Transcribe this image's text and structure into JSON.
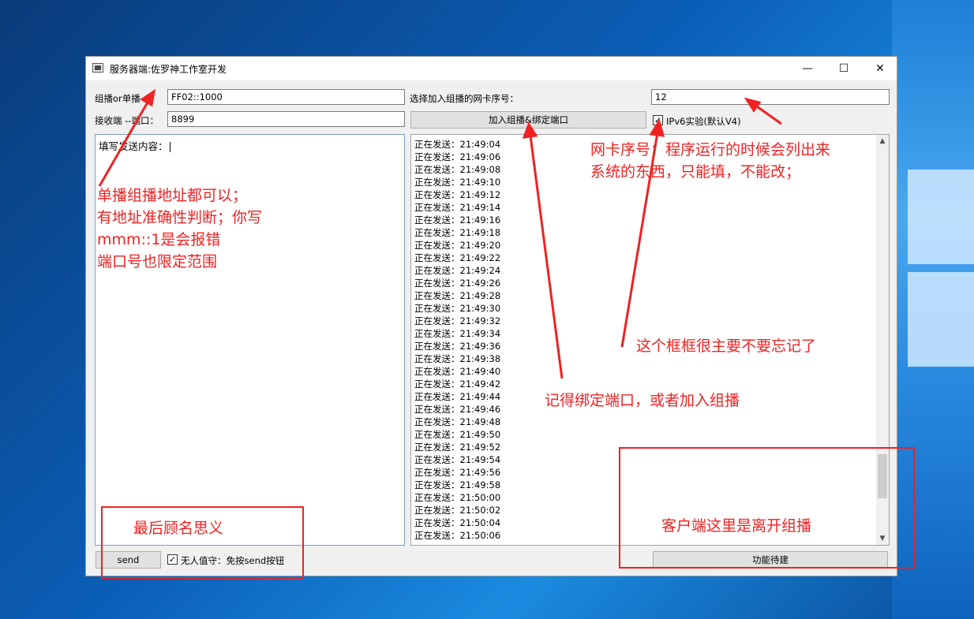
{
  "window": {
    "title": "服务器端:佐罗神工作室开发",
    "controls": {
      "minimize": "—",
      "maximize": "☐",
      "close": "✕"
    }
  },
  "form": {
    "group_label": "组播or单播  ：",
    "group_value": "FF02::1000",
    "port_label": "接收端 --端口：",
    "port_value": "8899",
    "nic_label": "选择加入组播的网卡序号：",
    "nic_value": "12",
    "join_button": "加入组播&绑定端口",
    "ipv6_label": "IPv6实验(默认V4)",
    "ipv6_checked": "✓"
  },
  "send_area": {
    "text": "填写发送内容："
  },
  "log": {
    "lines": [
      "正在发送：21:49:04",
      "正在发送：21:49:06",
      "正在发送：21:49:08",
      "正在发送：21:49:10",
      "正在发送：21:49:12",
      "正在发送：21:49:14",
      "正在发送：21:49:16",
      "正在发送：21:49:18",
      "正在发送：21:49:20",
      "正在发送：21:49:22",
      "正在发送：21:49:24",
      "正在发送：21:49:26",
      "正在发送：21:49:28",
      "正在发送：21:49:30",
      "正在发送：21:49:32",
      "正在发送：21:49:34",
      "正在发送：21:49:36",
      "正在发送：21:49:38",
      "正在发送：21:49:40",
      "正在发送：21:49:42",
      "正在发送：21:49:44",
      "正在发送：21:49:46",
      "正在发送：21:49:48",
      "正在发送：21:49:50",
      "正在发送：21:49:52",
      "正在发送：21:49:54",
      "正在发送：21:49:56",
      "正在发送：21:49:58",
      "正在发送：21:50:00",
      "正在发送：21:50:02",
      "正在发送：21:50:04",
      "正在发送：21:50:06"
    ],
    "scroll_position": 0.9
  },
  "bottom": {
    "send_button": "send",
    "unattended_label": "无人值守：免按send按钮",
    "unattended_checked": "✓",
    "func_button": "功能待建"
  },
  "annotations": {
    "addr_note": [
      "单播组播地址都可以；",
      "有地址准确性判断；你写",
      "mmm::1是会报错",
      "端口号也限定范围"
    ],
    "nic_note": [
      "网卡序号：程序运行的时候会列出来",
      "系统的东西，只能填，不能改；"
    ],
    "checkbox_note": "这个框框很主要不要忘记了",
    "bind_note": "记得绑定端口，或者加入组播",
    "bottom_left_note": "最后顾名思义",
    "bottom_right_note": "客户端这里是离开组播"
  },
  "colors": {
    "annotation": "#ee2222",
    "window_bg": "#f0f0f0"
  }
}
